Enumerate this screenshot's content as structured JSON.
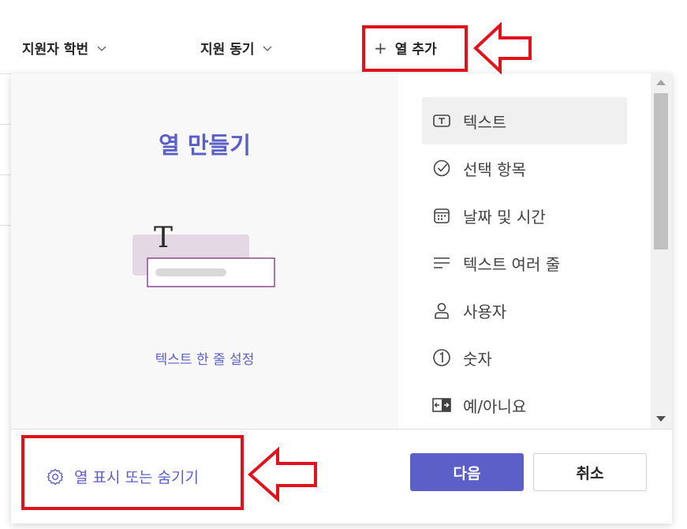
{
  "header": {
    "columns": [
      {
        "label": "지원자 학번"
      },
      {
        "label": "지원 동기"
      }
    ],
    "add_column": {
      "icon": "plus-icon",
      "label": "열 추가"
    }
  },
  "panel": {
    "preview": {
      "title": "열 만들기",
      "illustration_icon": "T",
      "description": "텍스트 한 줄 설정"
    },
    "types": [
      {
        "label": "텍스트",
        "icon": "text-box-icon",
        "selected": true
      },
      {
        "label": "선택 항목",
        "icon": "check-circle-icon",
        "selected": false
      },
      {
        "label": "날짜 및 시간",
        "icon": "calendar-icon",
        "selected": false
      },
      {
        "label": "텍스트 여러 줄",
        "icon": "multiline-text-icon",
        "selected": false
      },
      {
        "label": "사용자",
        "icon": "person-icon",
        "selected": false
      },
      {
        "label": "숫자",
        "icon": "number-circle-icon",
        "selected": false
      },
      {
        "label": "예/아니요",
        "icon": "toggle-icon",
        "selected": false
      }
    ],
    "footer": {
      "show_hide_label": "열 표시 또는 숨기기",
      "next_label": "다음",
      "cancel_label": "취소"
    }
  },
  "colors": {
    "accent": "#5b5fc7",
    "annotation": "#e0121b"
  }
}
